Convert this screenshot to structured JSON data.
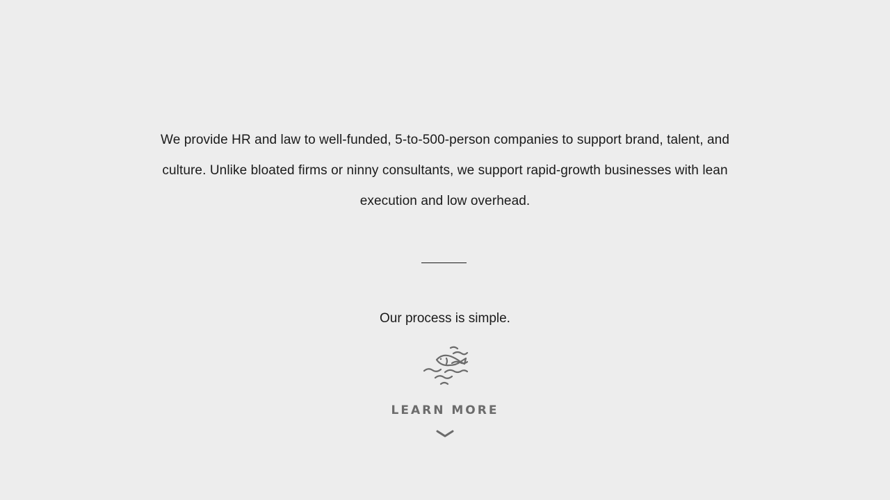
{
  "intro": {
    "text": "We provide HR and law to well-funded, 5-to-500-person companies to support brand, talent, and culture. Unlike bloated firms or ninny consultants, we support rapid-growth businesses with lean execution and low overhead."
  },
  "process": {
    "text": "Our process is simple."
  },
  "icon": {
    "name": "fish-waves-icon"
  },
  "cta": {
    "label": "LEARN MORE",
    "icon": "chevron-down-icon"
  },
  "colors": {
    "background": "#ededed",
    "text": "#1a1a1a",
    "accent_gray": "#6b6b6b"
  }
}
